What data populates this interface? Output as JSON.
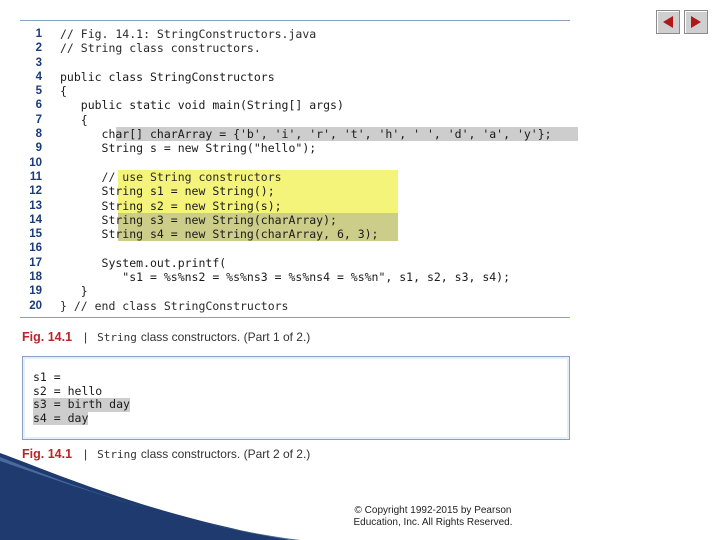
{
  "nav": {
    "prev_label": "previous slide",
    "next_label": "next slide"
  },
  "code_lines": [
    {
      "n": "1",
      "text": "// Fig. 14.1: StringConstructors.java"
    },
    {
      "n": "2",
      "text": "// String class constructors."
    },
    {
      "n": "3",
      "text": ""
    },
    {
      "n": "4",
      "text": "public class StringConstructors"
    },
    {
      "n": "5",
      "text": "{"
    },
    {
      "n": "6",
      "text": "   public static void main(String[] args)"
    },
    {
      "n": "7",
      "text": "   {"
    },
    {
      "n": "8",
      "text": "      char[] charArray = {'b', 'i', 'r', 't', 'h', ' ', 'd', 'a', 'y'};"
    },
    {
      "n": "9",
      "text": "      String s = new String(\"hello\");"
    },
    {
      "n": "10",
      "text": ""
    },
    {
      "n": "11",
      "text": "      // use String constructors"
    },
    {
      "n": "12",
      "text": "      String s1 = new String();"
    },
    {
      "n": "13",
      "text": "      String s2 = new String(s);"
    },
    {
      "n": "14",
      "text": "      String s3 = new String(charArray);"
    },
    {
      "n": "15",
      "text": "      String s4 = new String(charArray, 6, 3);"
    },
    {
      "n": "16",
      "text": ""
    },
    {
      "n": "17",
      "text": "      System.out.printf("
    },
    {
      "n": "18",
      "text": "         \"s1 = %s%ns2 = %s%ns3 = %s%ns4 = %s%n\", s1, s2, s3, s4);"
    },
    {
      "n": "19",
      "text": "   }"
    },
    {
      "n": "20",
      "text": "} // end class StringConstructors"
    }
  ],
  "caption1": {
    "fig": "Fig. 14.1",
    "sep": "|",
    "mono": "String",
    "rest": "class constructors. (Part 1 of 2.)"
  },
  "output_lines": [
    "s1 =",
    "s2 = hello",
    "s3 = birth day",
    "s4 = day"
  ],
  "caption2": {
    "fig": "Fig. 14.1",
    "sep": "|",
    "mono": "String",
    "rest": "class constructors. (Part 2 of 2.)"
  },
  "copyright": {
    "line1": "© Copyright 1992-2015 by Pearson",
    "line2": "Education, Inc. All Rights Reserved."
  }
}
